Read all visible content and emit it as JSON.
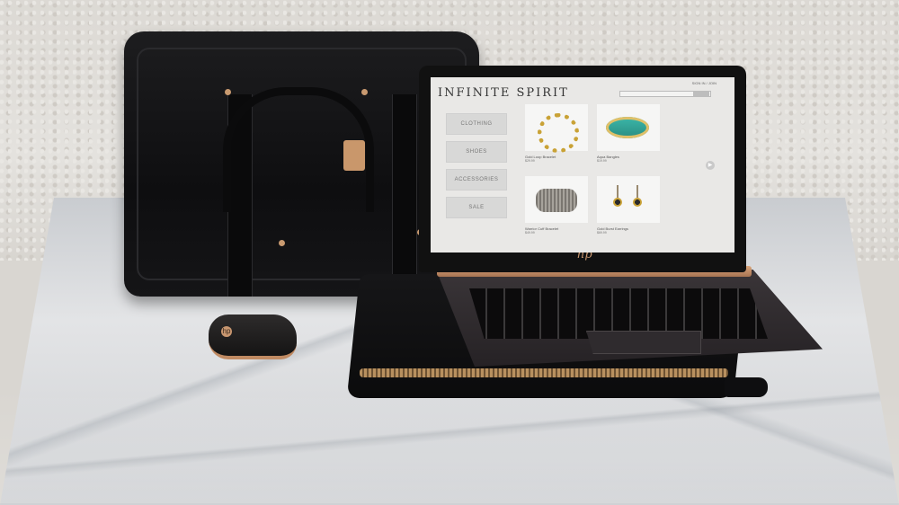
{
  "scene": {
    "objects": [
      "briefcase-icon",
      "laptop-icon",
      "mouse-icon",
      "sleeve-icon"
    ]
  },
  "screen": {
    "brand": "INFINITE SPIRIT",
    "signin": "SIGN IN / JOIN",
    "menu": [
      {
        "label": "CLOTHING"
      },
      {
        "label": "SHOES"
      },
      {
        "label": "ACCESSORIES"
      },
      {
        "label": "SALE"
      }
    ],
    "products": [
      {
        "name": "Gold Loop Bracelet",
        "price": "$29.99"
      },
      {
        "name": "Aqua Bangles",
        "price": "$19.99"
      },
      {
        "name": "Warrior Cuff Bracelet",
        "price": "$49.99"
      },
      {
        "name": "Gold Burst Earrings",
        "price": "$69.99"
      }
    ]
  },
  "laptop": {
    "logo": "hp"
  },
  "mouse": {
    "logo": "hp"
  },
  "colors": {
    "leather": "#111113",
    "copper": "#c99770",
    "screen_bg": "#e9e8e6",
    "marble": "#d6d8db"
  }
}
